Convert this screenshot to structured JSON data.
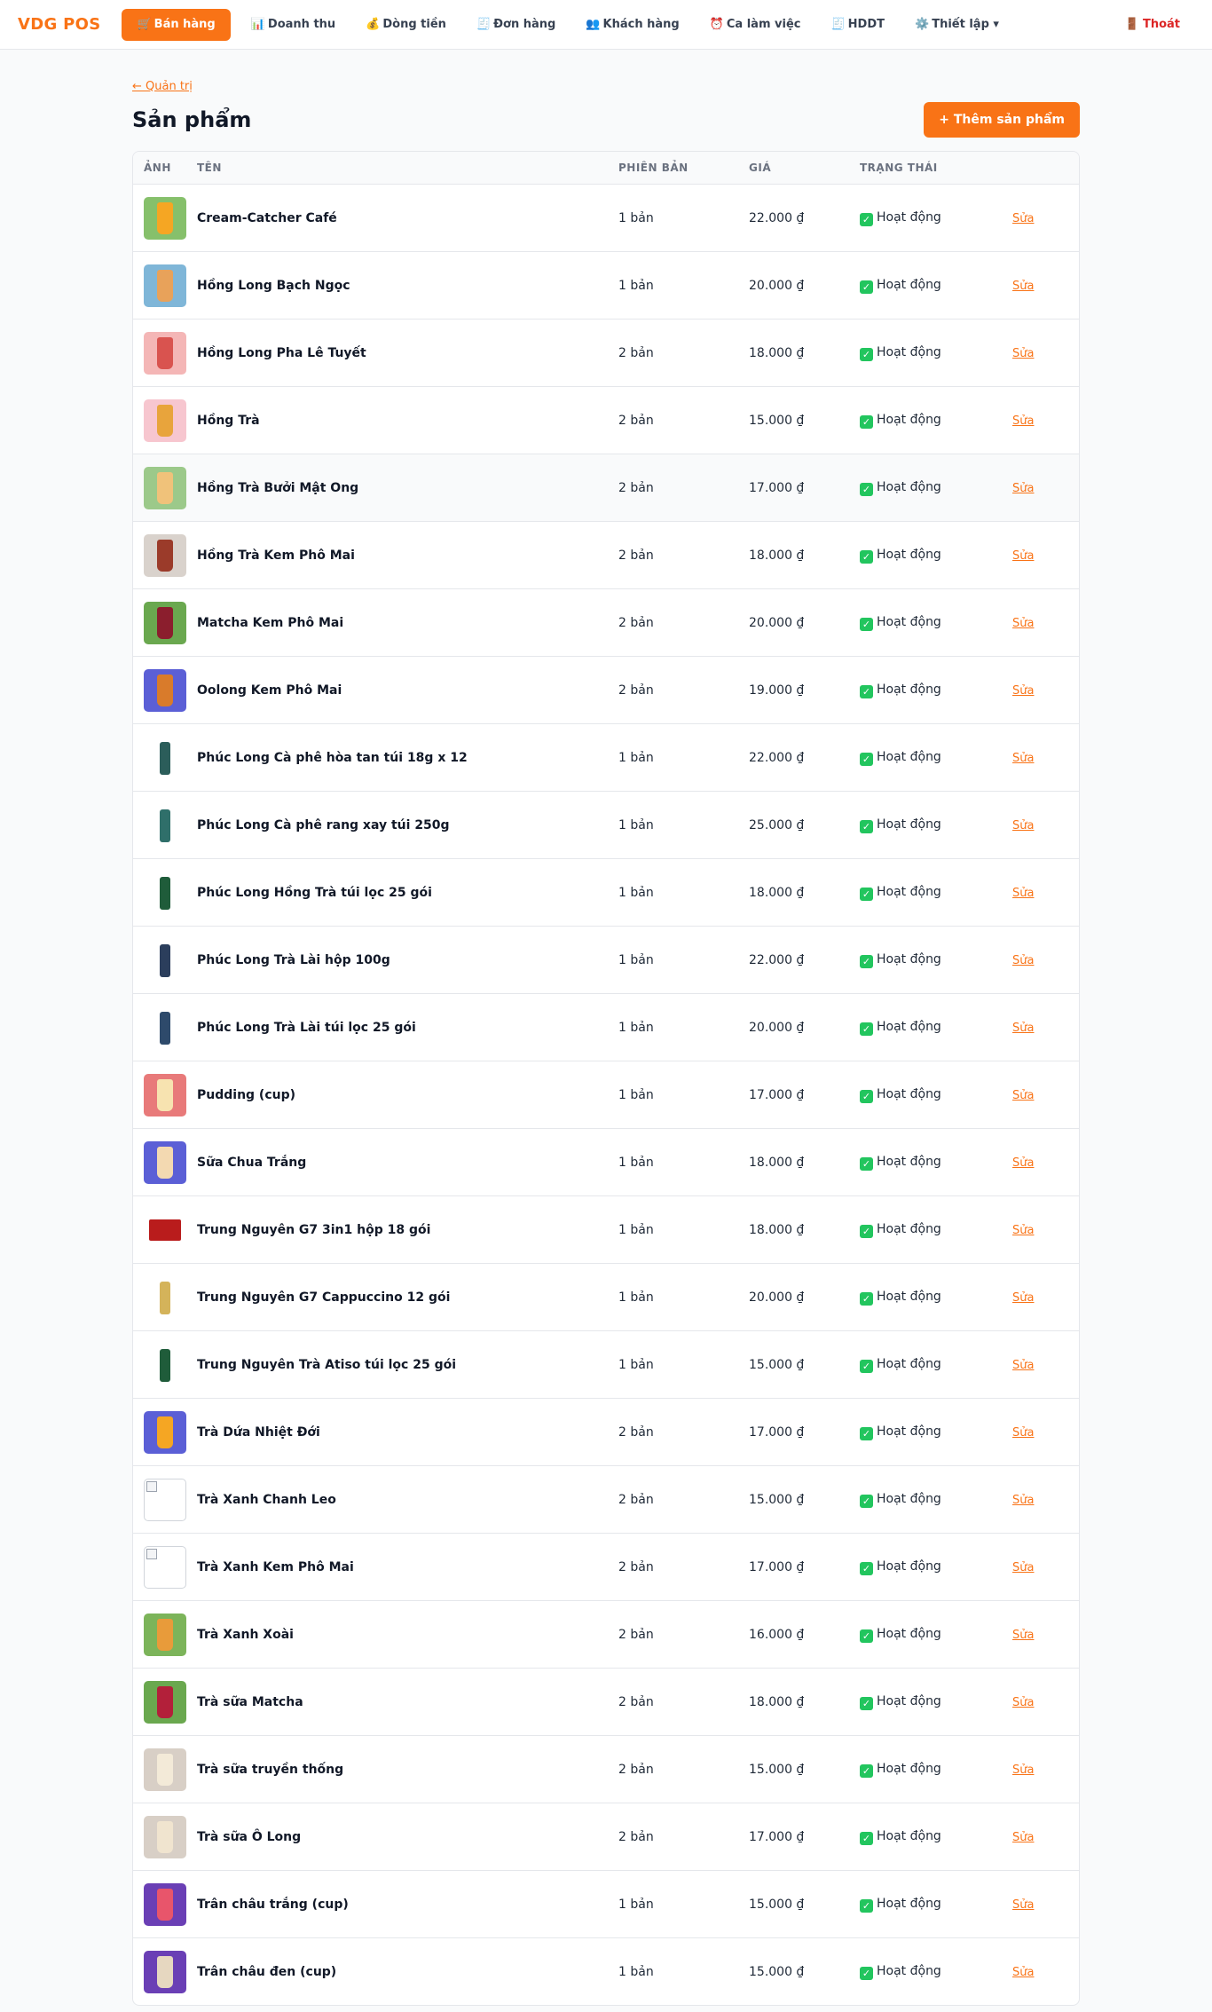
{
  "app": {
    "brand": "VDG POS",
    "nav": [
      {
        "icon": "🛒",
        "label": "Bán hàng",
        "active": true
      },
      {
        "icon": "📊",
        "label": "Doanh thu"
      },
      {
        "icon": "💰",
        "label": "Dòng tiền"
      },
      {
        "icon": "🧾",
        "label": "Đơn hàng"
      },
      {
        "icon": "👥",
        "label": "Khách hàng"
      },
      {
        "icon": "⏰",
        "label": "Ca làm việc"
      },
      {
        "icon": "🧾",
        "label": "HDDT"
      },
      {
        "icon": "⚙️",
        "label": "Thiết lập ▾"
      }
    ],
    "logout": {
      "icon": "🚪",
      "label": "Thoát"
    }
  },
  "page": {
    "back_link": "← Quản trị",
    "title": "Sản phẩm",
    "add_button": "+ Thêm sản phẩm"
  },
  "table": {
    "headers": {
      "image": "ẢNH",
      "name": "TÊN",
      "variants": "PHIÊN BẢN",
      "price": "GIÁ",
      "status": "TRẠNG THÁI"
    },
    "status_icon": "✓",
    "rows": [
      {
        "name": "Cream-Catcher Café",
        "variants": "1 bản",
        "price": "22.000 ₫",
        "status": "Hoạt động",
        "action": "Sửa",
        "thumb": "drink",
        "bg": "#86c06b",
        "fg": "#f5a623"
      },
      {
        "name": "Hồng Long Bạch Ngọc",
        "variants": "1 bản",
        "price": "20.000 ₫",
        "status": "Hoạt động",
        "action": "Sửa",
        "thumb": "drink",
        "bg": "#7fb6d8",
        "fg": "#e8a25a"
      },
      {
        "name": "Hồng Long Pha Lê Tuyết",
        "variants": "2 bản",
        "price": "18.000 ₫",
        "status": "Hoạt động",
        "action": "Sửa",
        "thumb": "drink",
        "bg": "#f4b6b6",
        "fg": "#d9534f"
      },
      {
        "name": "Hồng Trà",
        "variants": "2 bản",
        "price": "15.000 ₫",
        "status": "Hoạt động",
        "action": "Sửa",
        "thumb": "drink",
        "bg": "#f7c6cf",
        "fg": "#e8a43c"
      },
      {
        "name": "Hồng Trà Bưởi Mật Ong",
        "variants": "2 bản",
        "price": "17.000 ₫",
        "status": "Hoạt động",
        "action": "Sửa",
        "thumb": "drink",
        "bg": "#9cc98a",
        "fg": "#f0c27a"
      },
      {
        "name": "Hồng Trà Kem Phô Mai",
        "variants": "2 bản",
        "price": "18.000 ₫",
        "status": "Hoạt động",
        "action": "Sửa",
        "thumb": "drink",
        "bg": "#d9d2cc",
        "fg": "#9b3b2a"
      },
      {
        "name": "Matcha Kem Phô Mai",
        "variants": "2 bản",
        "price": "20.000 ₫",
        "status": "Hoạt động",
        "action": "Sửa",
        "thumb": "drink",
        "bg": "#6aa84f",
        "fg": "#8b1e2d"
      },
      {
        "name": "Oolong Kem Phô Mai",
        "variants": "2 bản",
        "price": "19.000 ₫",
        "status": "Hoạt động",
        "action": "Sửa",
        "thumb": "drink",
        "bg": "#5b5fd6",
        "fg": "#d97b2b"
      },
      {
        "name": "Phúc Long Cà phê hòa tan túi 18g x 12",
        "variants": "1 bản",
        "price": "22.000 ₫",
        "status": "Hoạt động",
        "action": "Sửa",
        "thumb": "pack",
        "bg": "#ffffff",
        "fg": "#2b5d5a"
      },
      {
        "name": "Phúc Long Cà phê rang xay túi 250g",
        "variants": "1 bản",
        "price": "25.000 ₫",
        "status": "Hoạt động",
        "action": "Sửa",
        "thumb": "pack",
        "bg": "#ffffff",
        "fg": "#2f6f6a"
      },
      {
        "name": "Phúc Long Hồng Trà túi lọc 25 gói",
        "variants": "1 bản",
        "price": "18.000 ₫",
        "status": "Hoạt động",
        "action": "Sửa",
        "thumb": "pack",
        "bg": "#ffffff",
        "fg": "#1f5c3a"
      },
      {
        "name": "Phúc Long Trà Lài hộp 100g",
        "variants": "1 bản",
        "price": "22.000 ₫",
        "status": "Hoạt động",
        "action": "Sửa",
        "thumb": "pack",
        "bg": "#ffffff",
        "fg": "#2b3e5c"
      },
      {
        "name": "Phúc Long Trà Lài túi lọc 25 gói",
        "variants": "1 bản",
        "price": "20.000 ₫",
        "status": "Hoạt động",
        "action": "Sửa",
        "thumb": "pack",
        "bg": "#ffffff",
        "fg": "#2e4a6b"
      },
      {
        "name": "Pudding (cup)",
        "variants": "1 bản",
        "price": "17.000 ₫",
        "status": "Hoạt động",
        "action": "Sửa",
        "thumb": "drink",
        "bg": "#e87a7a",
        "fg": "#f7e3b0"
      },
      {
        "name": "Sữa Chua Trắng",
        "variants": "1 bản",
        "price": "18.000 ₫",
        "status": "Hoạt động",
        "action": "Sửa",
        "thumb": "drink",
        "bg": "#5b5fd6",
        "fg": "#f3d9b1"
      },
      {
        "name": "Trung Nguyên G7 3in1 hộp 18 gói",
        "variants": "1 bản",
        "price": "18.000 ₫",
        "status": "Hoạt động",
        "action": "Sửa",
        "thumb": "box",
        "bg": "#ffffff",
        "fg": "#b91c1c"
      },
      {
        "name": "Trung Nguyên G7 Cappuccino 12 gói",
        "variants": "1 bản",
        "price": "20.000 ₫",
        "status": "Hoạt động",
        "action": "Sửa",
        "thumb": "pack",
        "bg": "#ffffff",
        "fg": "#d4b35a"
      },
      {
        "name": "Trung Nguyên Trà Atiso túi lọc 25 gói",
        "variants": "1 bản",
        "price": "15.000 ₫",
        "status": "Hoạt động",
        "action": "Sửa",
        "thumb": "pack",
        "bg": "#ffffff",
        "fg": "#1f5c3a"
      },
      {
        "name": "Trà Dứa Nhiệt Đới",
        "variants": "2 bản",
        "price": "17.000 ₫",
        "status": "Hoạt động",
        "action": "Sửa",
        "thumb": "drink",
        "bg": "#5b5fd6",
        "fg": "#f5a623"
      },
      {
        "name": "Trà Xanh Chanh Leo",
        "variants": "2 bản",
        "price": "15.000 ₫",
        "status": "Hoạt động",
        "action": "Sửa",
        "thumb": "broken",
        "bg": "#ffffff",
        "fg": "#9ca3af"
      },
      {
        "name": "Trà Xanh Kem Phô Mai",
        "variants": "2 bản",
        "price": "17.000 ₫",
        "status": "Hoạt động",
        "action": "Sửa",
        "thumb": "broken",
        "bg": "#ffffff",
        "fg": "#9ca3af"
      },
      {
        "name": "Trà Xanh Xoài",
        "variants": "2 bản",
        "price": "16.000 ₫",
        "status": "Hoạt động",
        "action": "Sửa",
        "thumb": "drink",
        "bg": "#7cb45a",
        "fg": "#e89b3a"
      },
      {
        "name": "Trà sữa Matcha",
        "variants": "2 bản",
        "price": "18.000 ₫",
        "status": "Hoạt động",
        "action": "Sửa",
        "thumb": "drink",
        "bg": "#6aa84f",
        "fg": "#b3203a"
      },
      {
        "name": "Trà sữa truyền thống",
        "variants": "2 bản",
        "price": "15.000 ₫",
        "status": "Hoạt động",
        "action": "Sửa",
        "thumb": "drink",
        "bg": "#d8cfc6",
        "fg": "#f3ead8"
      },
      {
        "name": "Trà sữa Ô Long",
        "variants": "2 bản",
        "price": "17.000 ₫",
        "status": "Hoạt động",
        "action": "Sửa",
        "thumb": "drink",
        "bg": "#d8cfc6",
        "fg": "#f0e4cf"
      },
      {
        "name": "Trân châu trắng (cup)",
        "variants": "1 bản",
        "price": "15.000 ₫",
        "status": "Hoạt động",
        "action": "Sửa",
        "thumb": "drink",
        "bg": "#6a3fb5",
        "fg": "#e8556b"
      },
      {
        "name": "Trân châu đen (cup)",
        "variants": "1 bản",
        "price": "15.000 ₫",
        "status": "Hoạt động",
        "action": "Sửa",
        "thumb": "drink",
        "bg": "#6a3fb5",
        "fg": "#e6d7c0"
      }
    ]
  }
}
